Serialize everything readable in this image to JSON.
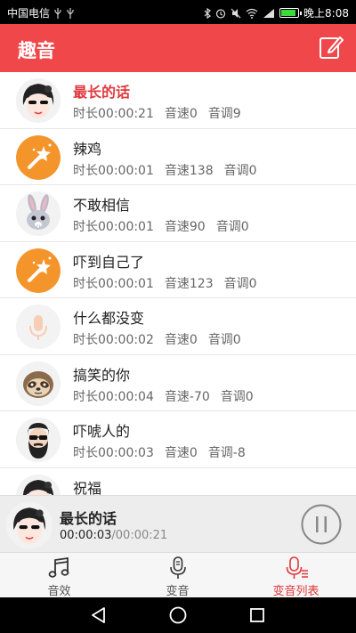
{
  "statusbar": {
    "carrier": "中国电信",
    "time": "晚上8:08",
    "battery_level": 0.9,
    "battery_color": "#3dd83d",
    "icons": [
      "usb-icon",
      "usb-icon",
      "bluetooth-icon",
      "alarm-icon",
      "mute-icon",
      "wifi-icon",
      "signal-icon"
    ]
  },
  "app": {
    "title": "趣音",
    "accent": "#f0474b",
    "edit_icon": "edit-icon"
  },
  "list": {
    "items": [
      {
        "name": "最长的话",
        "duration": "时长00:00:21",
        "speed": "音速0",
        "pitch": "音调9",
        "avatar": "girl-avatar",
        "active": true
      },
      {
        "name": "辣鸡",
        "duration": "时长00:00:01",
        "speed": "音速138",
        "pitch": "音调0",
        "avatar": "magic-wand-avatar",
        "active": false
      },
      {
        "name": "不敢相信",
        "duration": "时长00:00:01",
        "speed": "音速90",
        "pitch": "音调0",
        "avatar": "rabbit-avatar",
        "active": false
      },
      {
        "name": "吓到自己了",
        "duration": "时长00:00:01",
        "speed": "音速123",
        "pitch": "音调0",
        "avatar": "magic-wand-avatar",
        "active": false
      },
      {
        "name": "什么都没变",
        "duration": "时长00:00:02",
        "speed": "音速0",
        "pitch": "音调0",
        "avatar": "microphone-avatar",
        "active": false
      },
      {
        "name": "搞笑的你",
        "duration": "时长00:00:04",
        "speed": "音速-70",
        "pitch": "音调0",
        "avatar": "sloth-avatar",
        "active": false
      },
      {
        "name": "吓唬人的",
        "duration": "时长00:00:03",
        "speed": "音速0",
        "pitch": "音调-8",
        "avatar": "bearded-man-avatar",
        "active": false
      },
      {
        "name": "祝福",
        "duration": "",
        "speed": "",
        "pitch": "",
        "avatar": "girl-avatar",
        "active": false
      }
    ]
  },
  "player": {
    "name": "最长的话",
    "current": "00:00:03",
    "separator": "/",
    "total": "00:00:21",
    "pause_icon": "pause-icon"
  },
  "tabs": [
    {
      "label": "音效",
      "icon": "music-note-icon",
      "active": false
    },
    {
      "label": "变音",
      "icon": "microphone-icon",
      "active": false
    },
    {
      "label": "变音列表",
      "icon": "microphone-list-icon",
      "active": true
    }
  ],
  "navbar": [
    "back-icon",
    "home-icon",
    "recents-icon"
  ]
}
